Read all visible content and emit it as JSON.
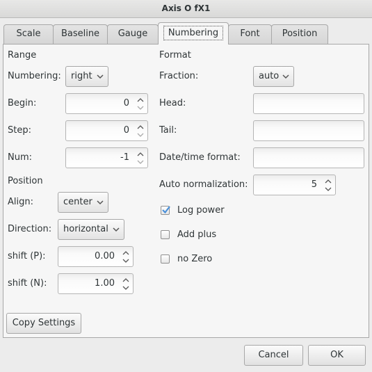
{
  "window": {
    "title": "Axis O fX1"
  },
  "tabs": [
    {
      "label": "Scale"
    },
    {
      "label": "Baseline"
    },
    {
      "label": "Gauge"
    },
    {
      "label": "Numbering"
    },
    {
      "label": "Font"
    },
    {
      "label": "Position"
    }
  ],
  "range": {
    "heading": "Range",
    "numbering_label": "Numbering:",
    "numbering_value": "right",
    "begin_label": "Begin:",
    "begin_value": "0",
    "step_label": "Step:",
    "step_value": "0",
    "num_label": "Num:",
    "num_value": "-1"
  },
  "position": {
    "heading": "Position",
    "align_label": "Align:",
    "align_value": "center",
    "direction_label": "Direction:",
    "direction_value": "horizontal",
    "shift_p_label": "shift (P):",
    "shift_p_value": "0.00",
    "shift_n_label": "shift (N):",
    "shift_n_value": "1.00"
  },
  "format": {
    "heading": "Format",
    "fraction_label": "Fraction:",
    "fraction_value": "auto",
    "head_label": "Head:",
    "head_value": "",
    "tail_label": "Tail:",
    "tail_value": "",
    "datetime_label": "Date/time format:",
    "datetime_value": "",
    "autonorm_label": "Auto normalization:",
    "autonorm_value": "5",
    "log_power_label": "Log power",
    "log_power_checked": true,
    "add_plus_label": "Add plus",
    "add_plus_checked": false,
    "no_zero_label": "no Zero",
    "no_zero_checked": false
  },
  "buttons": {
    "copy_settings": "Copy Settings",
    "cancel": "Cancel",
    "ok": "OK"
  },
  "icons": {
    "combo_arrow": "chevron-down-icon",
    "spin_up": "chevron-up-icon",
    "spin_down": "chevron-down-icon",
    "check": "checkmark-icon"
  },
  "colors": {
    "window_bg": "#ececec",
    "panel_bg": "#f6f6f6",
    "check_mark": "#4a90d9",
    "text": "#2e3436"
  }
}
